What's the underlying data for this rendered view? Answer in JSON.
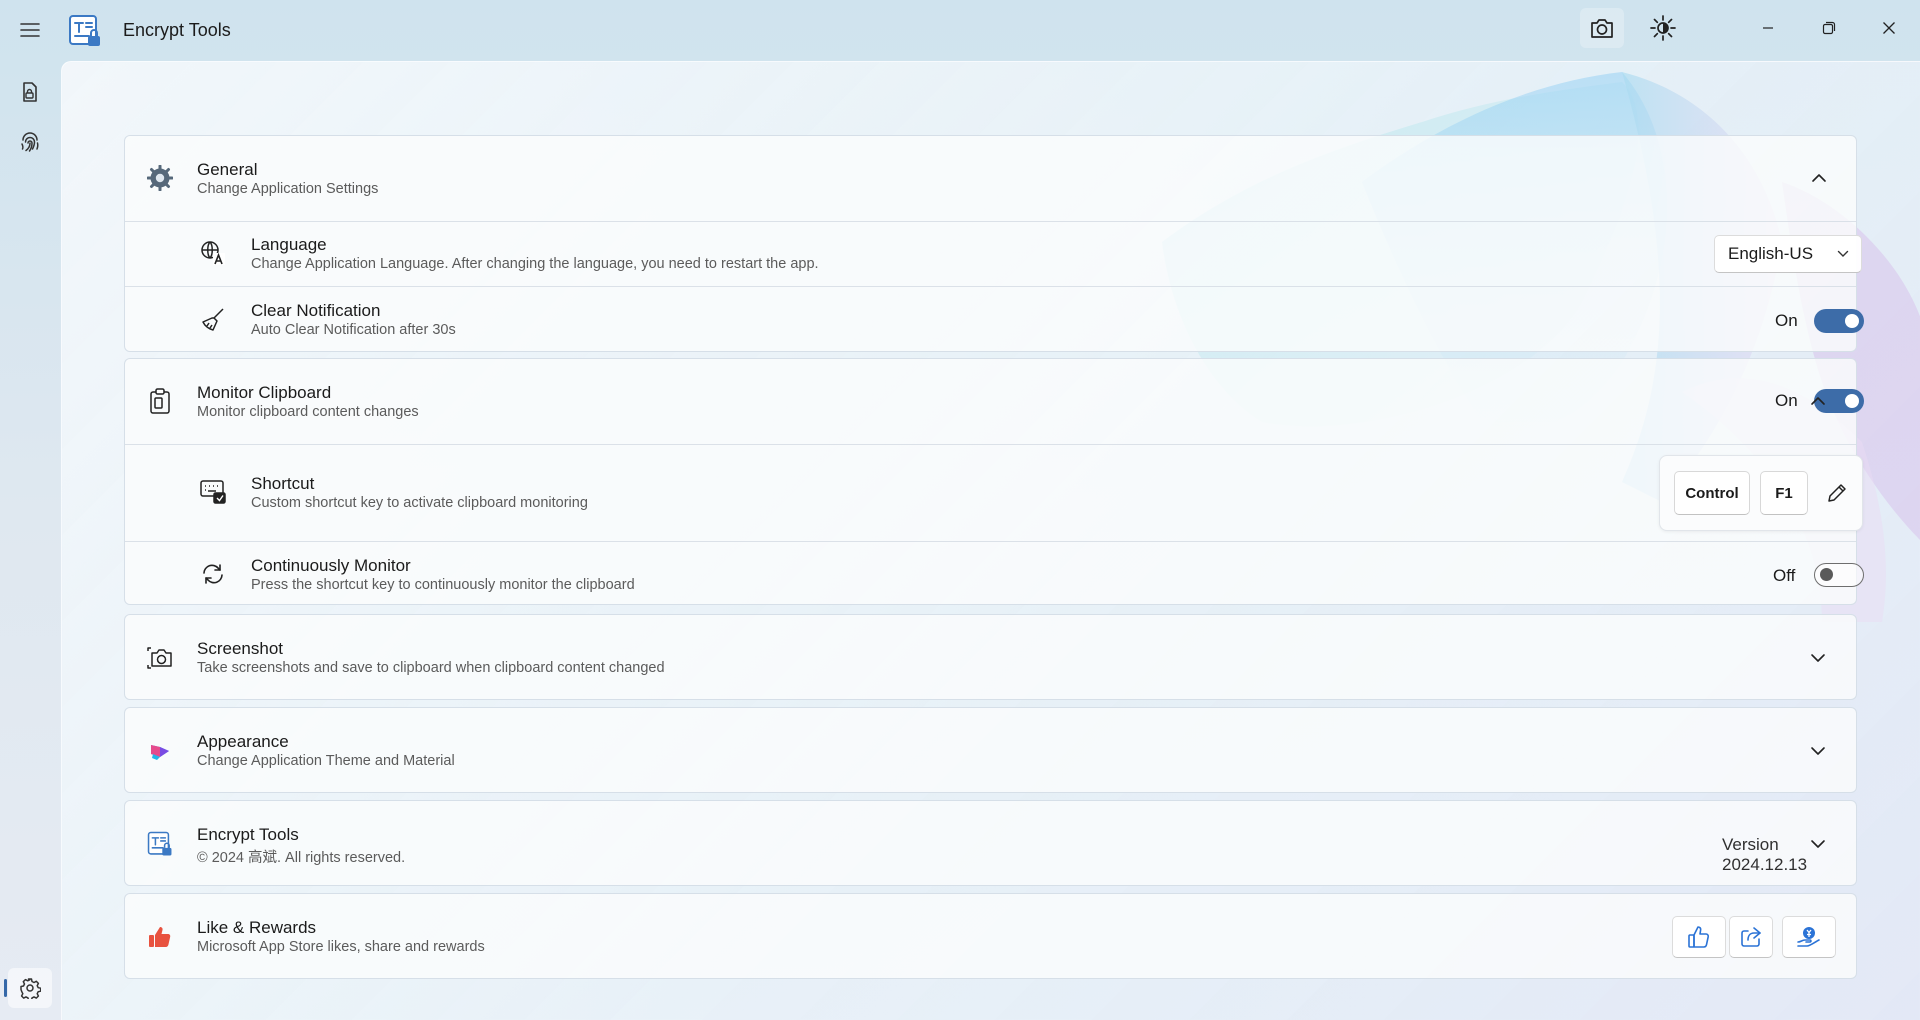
{
  "app": {
    "title": "Encrypt Tools"
  },
  "colors": {
    "accent": "#3d6ca8",
    "like_red": "#e8523f"
  },
  "titlebar_buttons": [
    "menu-icon",
    "camera-icon",
    "brightness-icon",
    "minimize-icon",
    "maximize-icon",
    "close-icon"
  ],
  "sidebar": {
    "items": [
      "file-lock-icon",
      "fingerprint-icon"
    ],
    "footer": "settings-icon"
  },
  "general": {
    "title": "General",
    "desc": "Change Application Settings",
    "language": {
      "title": "Language",
      "desc": "Change Application Language. After changing the language, you need to restart the app.",
      "value": "English-US"
    },
    "clear_notification": {
      "title": "Clear Notification",
      "desc": "Auto Clear Notification after 30s",
      "state": "On"
    }
  },
  "monitor_clipboard": {
    "title": "Monitor Clipboard",
    "desc": "Monitor clipboard content changes",
    "state": "On",
    "shortcut": {
      "title": "Shortcut",
      "desc": "Custom shortcut key to activate clipboard monitoring",
      "keys": [
        "Control",
        "F1"
      ]
    },
    "continuous": {
      "title": "Continuously Monitor",
      "desc": "Press the shortcut key to continuously monitor the clipboard",
      "state": "Off"
    }
  },
  "screenshot": {
    "title": "Screenshot",
    "desc": "Take screenshots and save to clipboard when clipboard content changed"
  },
  "appearance": {
    "title": "Appearance",
    "desc": "Change Application Theme and Material"
  },
  "about": {
    "title": "Encrypt Tools",
    "desc": "© 2024 高斌. All rights reserved.",
    "version": "Version 2024.12.13"
  },
  "like": {
    "title": "Like & Rewards",
    "desc": "Microsoft App Store likes, share and rewards",
    "buttons": [
      "thumbs-up-icon",
      "share-icon",
      "reward-icon"
    ]
  }
}
